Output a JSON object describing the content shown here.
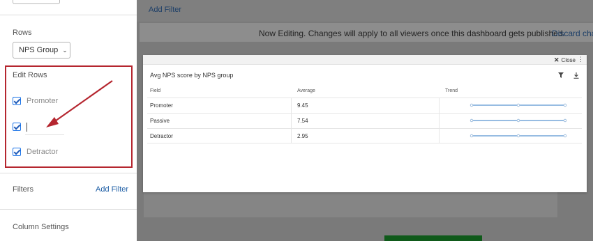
{
  "sidebar": {
    "rows_label": "Rows",
    "rows_select_value": "NPS Group",
    "edit_rows_label": "Edit Rows",
    "edit_rows": [
      {
        "label": "Promoter",
        "checked": true
      },
      {
        "label": "",
        "checked": true
      },
      {
        "label": "Detractor",
        "checked": true
      }
    ],
    "filters_label": "Filters",
    "add_filter_link": "Add Filter",
    "column_settings_label": "Column Settings"
  },
  "main": {
    "add_filter_link": "Add Filter",
    "banner_text": "Now Editing. Changes will apply to all viewers once this dashboard gets published.",
    "banner_link": "Discard char"
  },
  "modal": {
    "close_label": "Close",
    "widget_title": "Avg NPS score by NPS group",
    "columns": [
      "Field",
      "Average",
      "Trend"
    ],
    "rows": [
      {
        "field": "Promoter",
        "average": "9.45"
      },
      {
        "field": "Passive",
        "average": "7.54"
      },
      {
        "field": "Detractor",
        "average": "2.95"
      }
    ]
  },
  "colors": {
    "highlight_border": "#b5262f",
    "link": "#1f5fa6",
    "trend_line": "#2f78c4"
  }
}
